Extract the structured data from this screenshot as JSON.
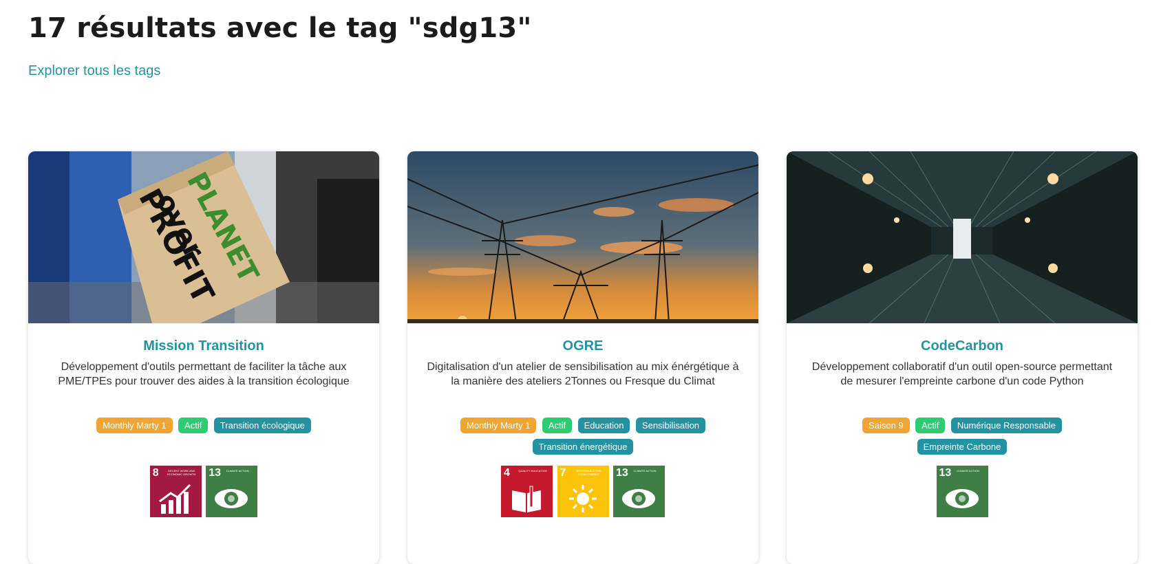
{
  "header": {
    "title": "17 résultats avec le tag \"sdg13\"",
    "explore_link": "Explorer tous les tags"
  },
  "cards": [
    {
      "title": "Mission Transition",
      "description": "Développement d'outils permettant de faciliter la tâche aux PME/TPEs pour trouver des aides à la transition écologique",
      "image_alt": "protest-sign-planet-over-profit",
      "image_text": [
        "PLANET",
        "over",
        "PROFIT"
      ],
      "badges": [
        {
          "label": "Monthly Marty 1",
          "kind": "orange"
        },
        {
          "label": "Actif",
          "kind": "green"
        },
        {
          "label": "Transition écologique",
          "kind": "teal"
        }
      ],
      "sdgs": [
        {
          "num": "8",
          "label": "DECENT WORK AND ECONOMIC GROWTH",
          "color": "#a21942",
          "icon": "growth-chart-icon"
        },
        {
          "num": "13",
          "label": "CLIMATE ACTION",
          "color": "#3f7e44",
          "icon": "eye-globe-icon"
        }
      ]
    },
    {
      "title": "OGRE",
      "description": "Digitalisation d'un atelier de sensibilisation au mix énérgétique à la manière des ateliers 2Tonnes ou Fresque du Climat",
      "image_alt": "power-lines-sunset",
      "badges": [
        {
          "label": "Monthly Marty 1",
          "kind": "orange"
        },
        {
          "label": "Actif",
          "kind": "green"
        },
        {
          "label": "Education",
          "kind": "teal"
        },
        {
          "label": "Sensibilisation",
          "kind": "teal"
        },
        {
          "label": "Transition énergétique",
          "kind": "teal"
        }
      ],
      "sdgs": [
        {
          "num": "4",
          "label": "QUALITY EDUCATION",
          "color": "#c5192d",
          "icon": "book-icon"
        },
        {
          "num": "7",
          "label": "AFFORDABLE AND CLEAN ENERGY",
          "color": "#fcc30b",
          "icon": "sun-icon"
        },
        {
          "num": "13",
          "label": "CLIMATE ACTION",
          "color": "#3f7e44",
          "icon": "eye-globe-icon"
        }
      ]
    },
    {
      "title": "CodeCarbon",
      "description": "Développement collaboratif d'un outil open-source permettant de mesurer l'empreinte carbone d'un code Python",
      "image_alt": "data-center-corridor",
      "badges": [
        {
          "label": "Saison 9",
          "kind": "orange"
        },
        {
          "label": "Actif",
          "kind": "green"
        },
        {
          "label": "Numérique Responsable",
          "kind": "teal"
        },
        {
          "label": "Empreinte Carbone",
          "kind": "teal"
        }
      ],
      "sdgs": [
        {
          "num": "13",
          "label": "CLIMATE ACTION",
          "color": "#3f7e44",
          "icon": "eye-globe-icon"
        }
      ]
    }
  ]
}
